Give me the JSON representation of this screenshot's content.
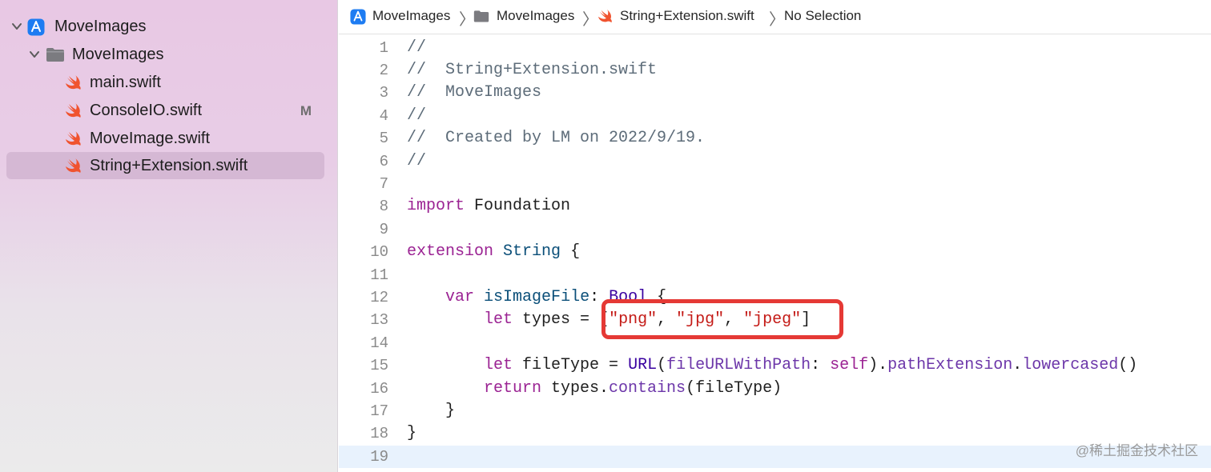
{
  "navigator": {
    "items": [
      {
        "label": "MoveImages",
        "icon": "app-project-icon",
        "expanded": true,
        "badge": "",
        "selected": false
      },
      {
        "label": "MoveImages",
        "icon": "folder-icon",
        "expanded": true,
        "badge": "",
        "selected": false
      },
      {
        "label": "main.swift",
        "icon": "swift-file-icon",
        "badge": "",
        "selected": false
      },
      {
        "label": "ConsoleIO.swift",
        "icon": "swift-file-icon",
        "badge": "M",
        "selected": false
      },
      {
        "label": "MoveImage.swift",
        "icon": "swift-file-icon",
        "badge": "",
        "selected": false
      },
      {
        "label": "String+Extension.swift",
        "icon": "swift-file-icon",
        "badge": "",
        "selected": true
      }
    ]
  },
  "jumpbar": {
    "crumbs": [
      "MoveImages",
      "MoveImages",
      "String+Extension.swift",
      "No Selection"
    ]
  },
  "editor": {
    "current_line": 19,
    "lines": [
      {
        "n": "1",
        "t": "//"
      },
      {
        "n": "2",
        "t": "//  String+Extension.swift"
      },
      {
        "n": "3",
        "t": "//  MoveImages"
      },
      {
        "n": "4",
        "t": "//"
      },
      {
        "n": "5",
        "t": "//  Created by LM on 2022/9/19."
      },
      {
        "n": "6",
        "t": "//"
      },
      {
        "n": "7",
        "t": ""
      },
      {
        "n": "8",
        "t": "import Foundation"
      },
      {
        "n": "9",
        "t": ""
      },
      {
        "n": "10",
        "t": "extension String {"
      },
      {
        "n": "11",
        "t": ""
      },
      {
        "n": "12",
        "t": "    var isImageFile: Bool {"
      },
      {
        "n": "13",
        "t": "        let types = [\"png\", \"jpg\", \"jpeg\"]"
      },
      {
        "n": "14",
        "t": ""
      },
      {
        "n": "15",
        "t": "        let fileType = URL(fileURLWithPath: self).pathExtension.lowercased()"
      },
      {
        "n": "16",
        "t": "        return types.contains(fileType)"
      },
      {
        "n": "17",
        "t": "    }"
      },
      {
        "n": "18",
        "t": "}"
      },
      {
        "n": "19",
        "t": ""
      }
    ]
  },
  "highlight": {
    "color": "#e53935"
  },
  "watermark": "@稀土掘金技术社区",
  "colors": {
    "keyword": "#9b2393",
    "string": "#c41a16",
    "comment": "#5d6c79",
    "type": "#3900a0",
    "selection": "#d5b8d4"
  }
}
